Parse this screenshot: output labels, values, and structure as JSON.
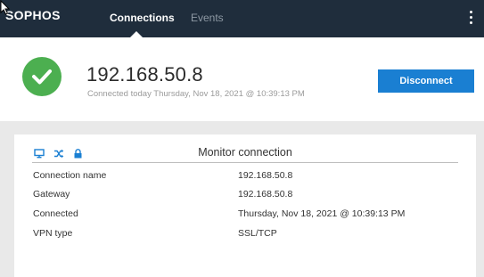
{
  "app": {
    "logo": "SOPHOS"
  },
  "nav": {
    "tabs": [
      {
        "label": "Connections",
        "active": true
      },
      {
        "label": "Events",
        "active": false
      }
    ]
  },
  "status": {
    "ip": "192.168.50.8",
    "subtitle": "Connected today Thursday, Nov 18, 2021 @ 10:39:13 PM",
    "state_color": "#4caf50",
    "disconnect_label": "Disconnect"
  },
  "monitor": {
    "title": "Monitor connection",
    "icons": [
      "monitor-icon",
      "shuffle-icon",
      "lock-icon"
    ],
    "rows": [
      {
        "label": "Connection name",
        "value": "192.168.50.8"
      },
      {
        "label": "Gateway",
        "value": "192.168.50.8"
      },
      {
        "label": "Connected",
        "value": "Thursday, Nov 18, 2021 @ 10:39:13 PM"
      },
      {
        "label": "VPN type",
        "value": "SSL/TCP"
      }
    ]
  },
  "colors": {
    "topbar": "#1f2d3c",
    "accent": "#1a7fd2",
    "icon_blue": "#1a7fd2",
    "background": "#e9e9e9"
  }
}
